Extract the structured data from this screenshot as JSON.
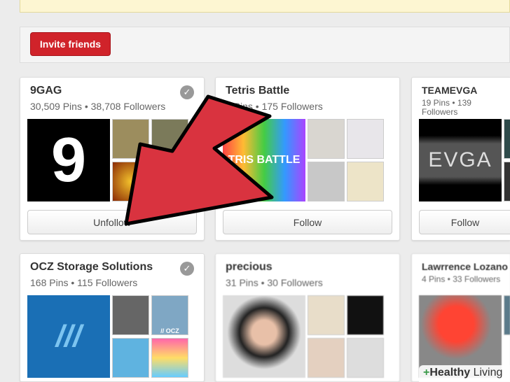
{
  "invite_label": "Invite friends",
  "boards": [
    {
      "name": "9GAG",
      "stats": "30,509 Pins • 38,708 Followers",
      "button": "Unfollow",
      "following": true
    },
    {
      "name": "Tetris Battle",
      "stats": "5 Pins • 175 Followers",
      "button": "Follow",
      "following": false
    },
    {
      "name": "TEAMEVGA",
      "stats": "19 Pins • 139 Followers",
      "button": "Follow",
      "following": false
    },
    {
      "name": "OCZ Storage Solutions",
      "stats": "168 Pins • 115 Followers",
      "following": true
    },
    {
      "name": "precious",
      "stats": "31 Pins • 30 Followers",
      "following": false
    },
    {
      "name": "Lawrrence Lozano",
      "stats": "4 Pins • 33 Followers",
      "following": false
    }
  ],
  "thumb_text": {
    "ninegag": "9",
    "tetris": "TRIS BATTLE",
    "evga": "EVGA",
    "ocz": "// OCZ"
  },
  "watermark": {
    "plus": "+",
    "bold": "Healthy",
    "light": " Living"
  },
  "colors": {
    "invite": "#d0232a",
    "arrow": "#d9333f"
  }
}
